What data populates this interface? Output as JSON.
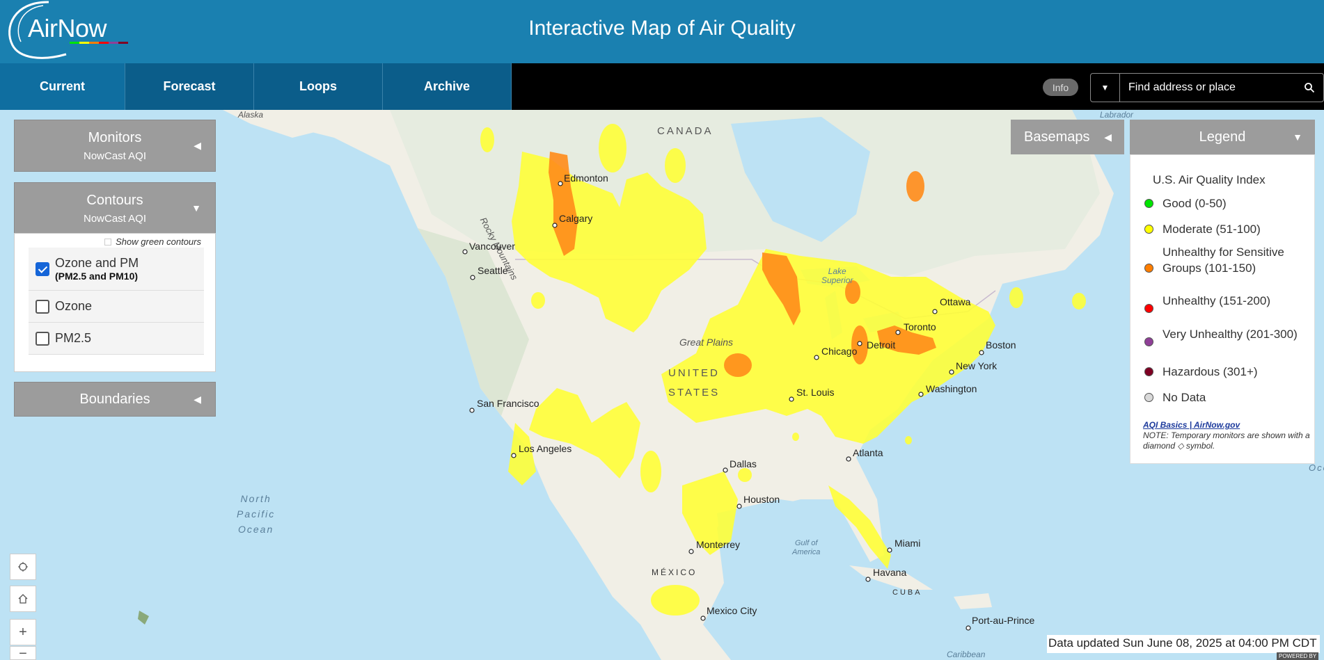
{
  "header": {
    "logo": "AirNow",
    "title": "Interactive Map of Air Quality",
    "logo_colors": [
      "#00e400",
      "#ffff00",
      "#ff7e00",
      "#ff0000",
      "#8f3f97",
      "#7e0023"
    ]
  },
  "nav": {
    "tabs": [
      {
        "label": "Current"
      },
      {
        "label": "Forecast"
      },
      {
        "label": "Loops"
      },
      {
        "label": "Archive"
      }
    ],
    "active_tab": "Current",
    "info_label": "Info",
    "search_placeholder": "Find address or place"
  },
  "left_panels": {
    "monitors": {
      "title": "Monitors",
      "subtitle": "NowCast AQI"
    },
    "contours": {
      "title": "Contours",
      "subtitle": "NowCast AQI",
      "show_green_label": "Show green contours",
      "options": [
        {
          "label": "Ozone and PM",
          "sub": "(PM2.5 and PM10)",
          "checked": true
        },
        {
          "label": "Ozone",
          "checked": false
        },
        {
          "label": "PM2.5",
          "checked": false
        }
      ]
    },
    "boundaries": {
      "title": "Boundaries"
    }
  },
  "right_panels": {
    "basemaps": {
      "title": "Basemaps"
    },
    "legend": {
      "title": "Legend",
      "heading": "U.S. Air Quality Index",
      "items": [
        {
          "label": "Good (0-50)",
          "color": "#00e400"
        },
        {
          "label": "Moderate (51-100)",
          "color": "#ffff00"
        },
        {
          "label": "Unhealthy for Sensitive Groups (101-150)",
          "color": "#ff7e00"
        },
        {
          "label": "Unhealthy (151-200)",
          "color": "#ff0000"
        },
        {
          "label": "Very Unhealthy (201-300)",
          "color": "#8f3f97"
        },
        {
          "label": "Hazardous (301+)",
          "color": "#7e0023"
        },
        {
          "label": "No Data",
          "color": "#d9d9d9"
        }
      ],
      "link": "AQI Basics | AirNow.gov",
      "note": "NOTE: Temporary monitors are shown with a diamond ◇ symbol."
    }
  },
  "map": {
    "labels": {
      "alaska": "Alaska",
      "canada": "CANADA",
      "labrador": "Labrador",
      "edmonton": "Edmonton",
      "calgary": "Calgary",
      "rocky": "Rocky Mountains",
      "vancouver": "Vancouver",
      "seattle": "Seattle",
      "lake_superior_1": "Lake",
      "lake_superior_2": "Superior",
      "ottawa": "Ottawa",
      "toronto": "Toronto",
      "boston": "Boston",
      "detroit": "Detroit",
      "chicago": "Chicago",
      "new_york": "New York",
      "great_plains": "Great Plains",
      "united": "UNITED",
      "states": "STATES",
      "washington": "Washington",
      "st_louis": "St. Louis",
      "san_francisco": "San Francisco",
      "los_angeles": "Los Angeles",
      "atlanta": "Atlanta",
      "dallas": "Dallas",
      "houston": "Houston",
      "miami": "Miami",
      "north_pacific_1": "North",
      "north_pacific_2": "Pacific",
      "north_pacific_3": "Ocean",
      "gulf_1": "Gulf of",
      "gulf_2": "America",
      "monterrey": "Monterrey",
      "havana": "Havana",
      "mexico": "MÉXICO",
      "cuba": "CUBA",
      "mexico_city": "Mexico City",
      "port_au_prince": "Port-au-Prince",
      "caribbean": "Caribbean",
      "ocean_right": "Oce"
    },
    "status": "Data updated Sun June 08, 2025 at 04:00 PM CDT",
    "credit": "POWERED BY"
  }
}
